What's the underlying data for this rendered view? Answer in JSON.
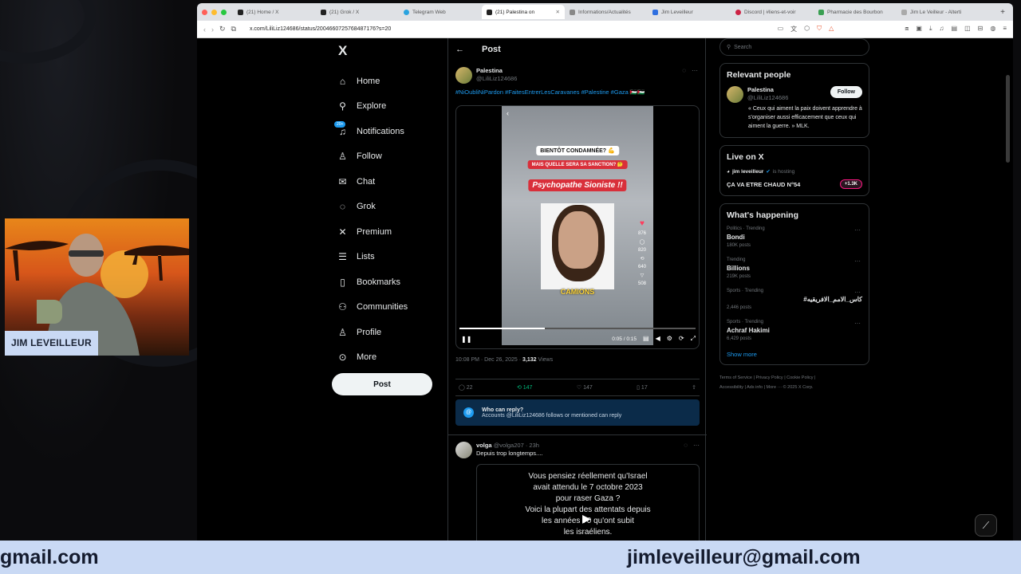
{
  "webcam": {
    "name_tag": "JIM LEVEILLEUR"
  },
  "banner": {
    "left_text": "gmail.com",
    "right_text": "jimleveilleur@gmail.com"
  },
  "browser": {
    "tabs": [
      {
        "label": "(21) Home / X"
      },
      {
        "label": "(21) Grok / X"
      },
      {
        "label": "Telegram Web"
      },
      {
        "label": "(21) Palestina on",
        "active": true
      },
      {
        "label": "Informations/Actualités"
      },
      {
        "label": "Jim Leveilleur"
      },
      {
        "label": "Discord | #liens-et-voir"
      },
      {
        "label": "Pharmacie des Bourbon"
      },
      {
        "label": "Jim Le Veilleur - Alterti"
      }
    ],
    "url": "x.com/LiliLiz124686/status/2004660725768487176?s=20"
  },
  "nav": {
    "logo": "X",
    "items": [
      {
        "label": "Home",
        "icon": "home-icon",
        "glyph": "⌂"
      },
      {
        "label": "Explore",
        "icon": "search-icon",
        "glyph": "⚲"
      },
      {
        "label": "Notifications",
        "icon": "bell-icon",
        "glyph": "♫",
        "badge": "20+"
      },
      {
        "label": "Follow",
        "icon": "person-add-icon",
        "glyph": "♙"
      },
      {
        "label": "Chat",
        "icon": "mail-icon",
        "glyph": "✉"
      },
      {
        "label": "Grok",
        "icon": "grok-icon",
        "glyph": "◌"
      },
      {
        "label": "Premium",
        "icon": "x-icon",
        "glyph": "✕"
      },
      {
        "label": "Lists",
        "icon": "list-icon",
        "glyph": "☰"
      },
      {
        "label": "Bookmarks",
        "icon": "bookmark-icon",
        "glyph": "▯"
      },
      {
        "label": "Communities",
        "icon": "communities-icon",
        "glyph": "⚇"
      },
      {
        "label": "Profile",
        "icon": "profile-icon",
        "glyph": "♙"
      },
      {
        "label": "More",
        "icon": "more-icon",
        "glyph": "⊙"
      }
    ],
    "post_button": "Post"
  },
  "post": {
    "header": "Post",
    "author_name": "Palestina",
    "author_handle": "@LiliLiz124686",
    "hashtags": "#NiOubliNiPardon #FaitesEntrerLesCaravanes #Palestine #Gaza 🇵🇸🇵🇸",
    "video": {
      "caption1": "BIENTÔT CONDAMNÉE? 💪",
      "caption2": "MAIS QUELLE SERA SA SANCTION? 🤔",
      "caption3": "Psychopathe Sioniste !!",
      "caption4": "CAMIONS",
      "likes": "876",
      "comments": "820",
      "shares": "640",
      "sends": "508",
      "time": "0:05 / 0:15"
    },
    "timestamp": "10:08 PM · Dec 26, 2025 · ",
    "views": "3,132",
    "views_label": " Views",
    "replies": "22",
    "reposts": "147",
    "likes": "147",
    "bookmarks": "17",
    "who_can_reply_title": "Who can reply?",
    "who_can_reply_text": "Accounts @LiliLiz124686 follows or mentioned can reply"
  },
  "reply": {
    "author": "volga",
    "handle": "@volga207 · 23h",
    "text": "Depuis trop longtemps....",
    "card_lines": [
      "Vous pensiez réellement qu'Israel",
      "avait attendu le 7 octobre 2023",
      "pour raser Gaza ?",
      "Voici la plupart des attentats depuis",
      "les années 70 qu'ont subit",
      "les israéliens."
    ]
  },
  "sidebar": {
    "search_placeholder": "Search",
    "relevant_title": "Relevant people",
    "relevant_name": "Palestina",
    "relevant_handle": "@LiliLiz124686",
    "follow_label": "Follow",
    "relevant_bio": "« Ceux qui aiment la paix doivent apprendre à s'organiser aussi efficacement que ceux qui aiment la guerre. » MLK.",
    "live_title": "Live on X",
    "live_host": "jim leveilleur",
    "live_hosting": "is hosting",
    "live_space": "ÇA VA ETRE CHAUD N°54",
    "live_count": "+1.3K",
    "happening_title": "What's happening",
    "trends": [
      {
        "category": "Politics · Trending",
        "name": "Bondi",
        "count": "180K posts"
      },
      {
        "category": "Trending",
        "name": "Billions",
        "count": "219K posts"
      },
      {
        "category": "Sports · Trending",
        "name": "#كاس_الامم_الافريقيه",
        "count": "2,446 posts",
        "rtl": true
      },
      {
        "category": "Sports · Trending",
        "name": "Achraf Hakimi",
        "count": "6,429 posts"
      }
    ],
    "show_more": "Show more",
    "footer_line1": "Terms of Service  |  Privacy Policy  |  Cookie Policy  |",
    "footer_line2": "Accessibility  |  Ads info  |  More ···  © 2025 X Corp."
  },
  "colors": {
    "accent": "#1d9bf0",
    "banner": "#c9d9f4",
    "repost": "#00ba7c"
  }
}
